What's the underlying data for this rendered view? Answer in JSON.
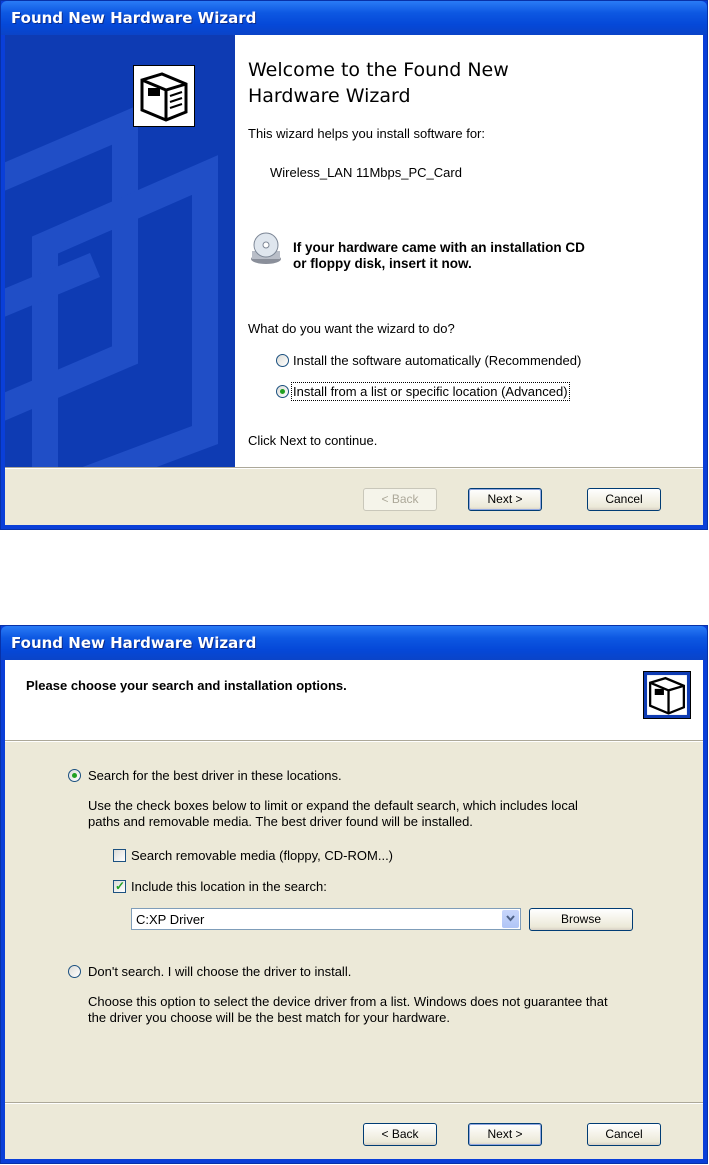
{
  "wizard1": {
    "title": "Found New Hardware Wizard",
    "heading": "Welcome to the Found New Hardware Wizard",
    "intro": "This wizard helps you install software for:",
    "device": "Wireless_LAN 11Mbps_PC_Card",
    "cd_prompt_line1": "If your hardware came with an installation CD",
    "cd_prompt_line2": "or floppy disk, insert it now.",
    "question": "What do you want the wizard to do?",
    "options": [
      {
        "label": "Install the software automatically (Recommended)",
        "selected": false
      },
      {
        "label": "Install from a list or specific location (Advanced)",
        "selected": true
      }
    ],
    "footer_hint": "Click Next to continue.",
    "buttons": {
      "back": "< Back",
      "next": "Next >",
      "cancel": "Cancel"
    },
    "icons": {
      "hardware": "hardware-card-icon",
      "cd": "cd-drive-icon"
    }
  },
  "wizard2": {
    "title": "Found New Hardware Wizard",
    "header": "Please choose your search and installation options.",
    "search_option": {
      "label": "Search for the best driver in these locations.",
      "selected": true
    },
    "search_desc_line1": "Use the check boxes below to limit or expand the default search, which includes local",
    "search_desc_line2": "paths and removable media. The best driver found will be installed.",
    "check_removable": {
      "label": "Search removable media (floppy, CD-ROM...)",
      "checked": false
    },
    "check_location": {
      "label": "Include this location in the search:",
      "checked": true
    },
    "location_value": "C:XP Driver",
    "browse": "Browse",
    "dont_search_option": {
      "label": "Don't search. I will choose the driver to install.",
      "selected": false
    },
    "dont_desc_line1": "Choose this option to select the device driver from a list.  Windows does not guarantee that",
    "dont_desc_line2": "the driver you choose will be the best match for your hardware.",
    "buttons": {
      "back": "< Back",
      "next": "Next >",
      "cancel": "Cancel"
    }
  },
  "colors": {
    "titlebar": "#0548d8",
    "side_panel": "#0e3bb3",
    "face": "#ece9d8",
    "radio_dot": "#21a121"
  }
}
